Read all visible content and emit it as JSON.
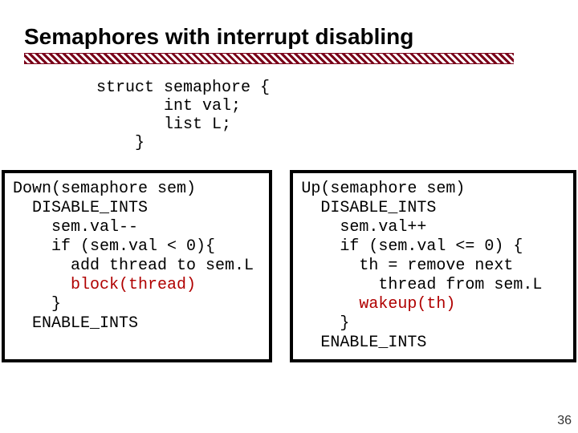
{
  "title": "Semaphores with interrupt disabling",
  "struct_code": "struct semaphore {\n       int val;\n       list L;\n    }",
  "down": {
    "l1": "Down(semaphore sem)",
    "l2": "  DISABLE_INTS",
    "l3": "    sem.val--",
    "l4": "    if (sem.val < 0){",
    "l5": "      add thread to sem.L",
    "l6": "      block(thread)",
    "l7": "    }",
    "l8": "  ENABLE_INTS"
  },
  "up": {
    "l1": "Up(semaphore sem)",
    "l2": "  DISABLE_INTS",
    "l3": "    sem.val++",
    "l4": "    if (sem.val <= 0) {",
    "l5": "      th = remove next",
    "l6": "        thread from sem.L",
    "l7": "      wakeup(th)",
    "l8": "    }",
    "l9": "  ENABLE_INTS"
  },
  "page_number": "36"
}
